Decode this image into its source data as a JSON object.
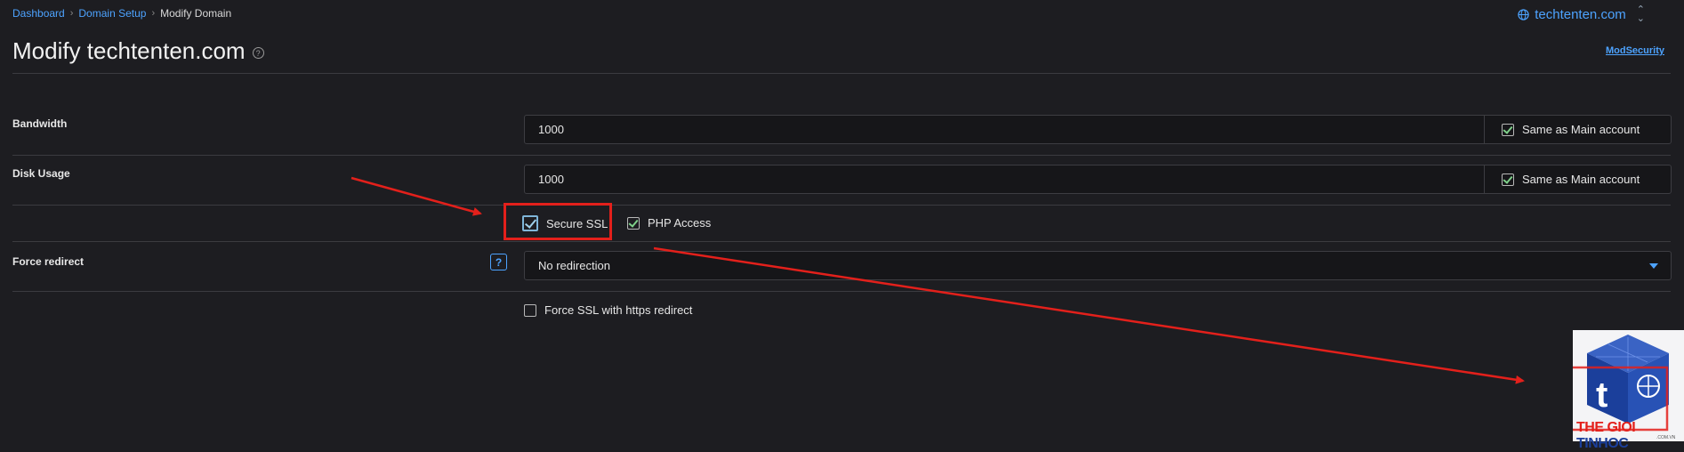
{
  "breadcrumb": {
    "items": [
      "Dashboard",
      "Domain Setup"
    ],
    "current": "Modify Domain"
  },
  "domain_selector": {
    "value": "techtenten.com",
    "icon": "globe-icon"
  },
  "page": {
    "title": "Modify techtenten.com",
    "mod_security_link": "ModSecurity"
  },
  "bandwidth": {
    "label": "Bandwidth",
    "value": "1000",
    "same_as_main_label": "Same as Main account",
    "same_as_main_checked": true
  },
  "disk_usage": {
    "label": "Disk Usage",
    "value": "1000",
    "same_as_main_label": "Same as Main account",
    "same_as_main_checked": true
  },
  "options": {
    "secure_ssl_label": "Secure SSL",
    "secure_ssl_checked": true,
    "php_access_label": "PHP Access",
    "php_access_checked": true
  },
  "force_redirect": {
    "label": "Force redirect",
    "help_icon": "?",
    "selected": "No redirection"
  },
  "force_ssl": {
    "label": "Force SSL with https redirect",
    "checked": false
  },
  "watermark": {
    "text_red": "THE GIOI ",
    "text_blue": "TINHOC",
    "sub": ".COM.VN",
    "letter": "t"
  },
  "colors": {
    "accent": "#4da3ff",
    "highlight": "#e3201b",
    "check": "#7fd18a",
    "background": "#1d1d21"
  }
}
